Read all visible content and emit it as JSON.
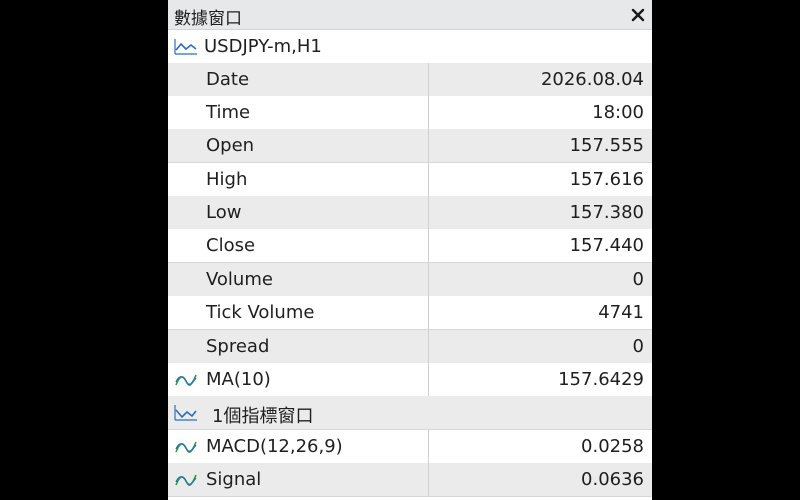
{
  "window": {
    "title": "數據窗口"
  },
  "symbol": {
    "label": "USDJPY-m,H1"
  },
  "fields": [
    {
      "label": "Date",
      "value": "2026.08.04"
    },
    {
      "label": "Time",
      "value": "18:00"
    },
    {
      "label": "Open",
      "value": "157.555"
    },
    {
      "label": "High",
      "value": "157.616"
    },
    {
      "label": "Low",
      "value": "157.380"
    },
    {
      "label": "Close",
      "value": "157.440"
    },
    {
      "label": "Volume",
      "value": "0"
    },
    {
      "label": "Tick Volume",
      "value": "4741"
    },
    {
      "label": "Spread",
      "value": "0"
    }
  ],
  "ma": {
    "label": "MA(10)",
    "value": "157.6429"
  },
  "subwindow": {
    "label": "1個指標窗口"
  },
  "macd": {
    "label": "MACD(12,26,9)",
    "value": "0.0258"
  },
  "signal": {
    "label": "Signal",
    "value": "0.0636"
  },
  "colors": {
    "chart_icon": "#2a6fb6",
    "indicator_icon_green": "#2e9e3e",
    "indicator_icon_blue": "#2a6fb6",
    "row_shade": "#ebebeb"
  },
  "icons": {
    "close": "close-icon",
    "chart": "chart-line-icon",
    "indicator": "indicator-line-icon"
  }
}
